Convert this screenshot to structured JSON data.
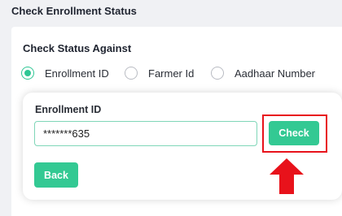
{
  "page": {
    "title": "Check Enrollment Status"
  },
  "status_form": {
    "section_title": "Check Status Against",
    "radio_options": [
      {
        "label": "Enrollment ID",
        "selected": true
      },
      {
        "label": "Farmer Id",
        "selected": false
      },
      {
        "label": "Aadhaar Number",
        "selected": false
      }
    ],
    "field_label": "Enrollment ID",
    "input_value": "*******635",
    "check_label": "Check",
    "back_label": "Back"
  },
  "colors": {
    "accent": "#33c993",
    "highlight": "#e8121b",
    "background": "#f0f1f4"
  },
  "annotation": {
    "icon": "up-arrow-icon",
    "highlight": "check-button"
  }
}
